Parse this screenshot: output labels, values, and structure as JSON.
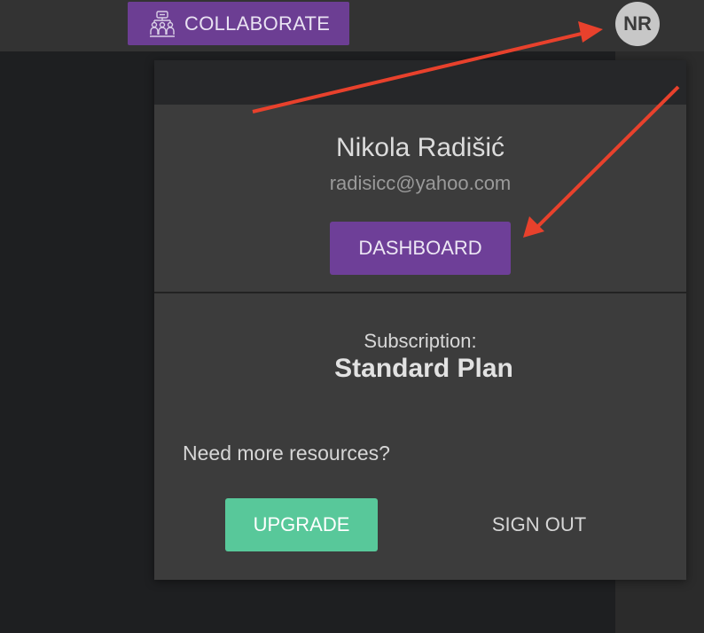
{
  "topbar": {
    "collaborate_label": "COLLABORATE",
    "collaborate_icon": "team-collaboration-icon",
    "avatar_initials": "NR"
  },
  "account_popover": {
    "user_name": "Nikola Radišić",
    "user_email": "radisicc@yahoo.com",
    "dashboard_label": "DASHBOARD",
    "subscription_label": "Subscription:",
    "subscription_plan": "Standard Plan",
    "resources_prompt": "Need more resources?",
    "upgrade_label": "UPGRADE",
    "signout_label": "SIGN OUT"
  },
  "colors": {
    "accent_purple": "#6e3f98",
    "upgrade_green": "#58c89a",
    "annotation_arrow": "#e8412c",
    "panel_bg": "#3c3c3c",
    "topbar_bg": "#333333"
  }
}
